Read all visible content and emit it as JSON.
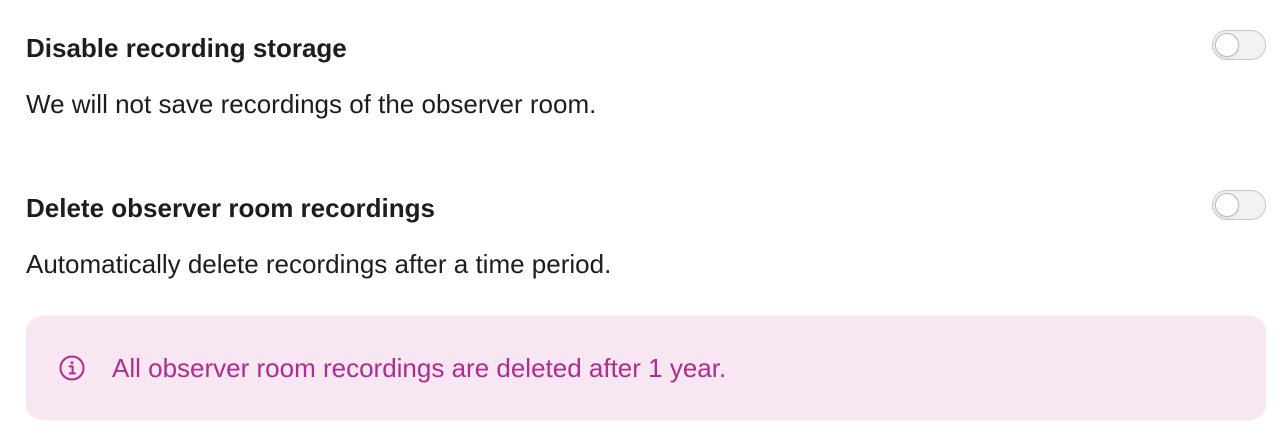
{
  "settings": [
    {
      "title": "Disable recording storage",
      "description": "We will not save recordings of the observer room.",
      "enabled": false
    },
    {
      "title": "Delete observer room recordings",
      "description": "Automatically delete recordings after a time period.",
      "enabled": false
    }
  ],
  "info_banner": {
    "icon": "info-icon",
    "text": "All observer room recordings are deleted after 1 year.",
    "background_color": "#f8e6f3",
    "text_color": "#b02c8f"
  }
}
